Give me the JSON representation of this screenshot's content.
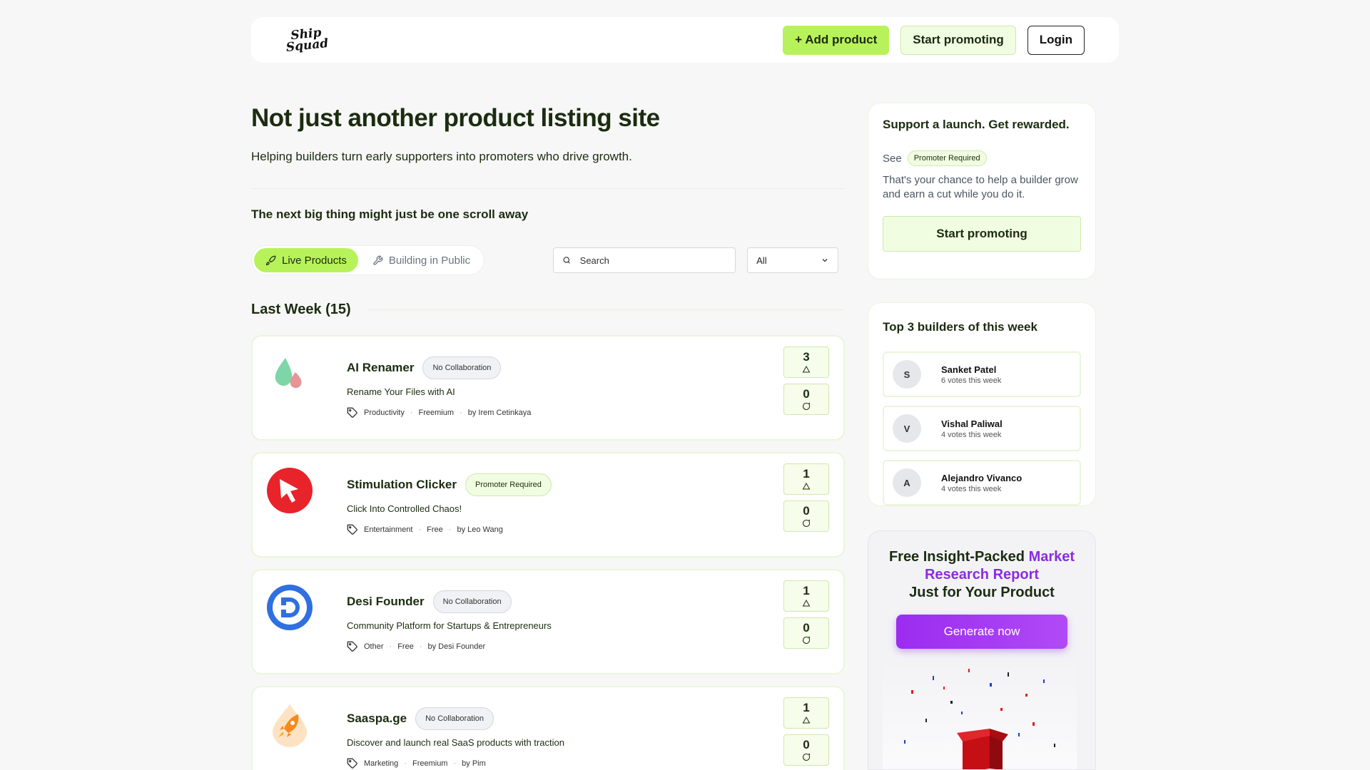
{
  "header": {
    "logo_line1": "Ship",
    "logo_line2": "Squad",
    "add_product": "+ Add product",
    "start_promoting": "Start promoting",
    "login": "Login"
  },
  "hero": {
    "title": "Not just another product listing site",
    "subtitle": "Helping builders turn early supporters into promoters who drive growth.",
    "next_big": "The next big thing might just be one scroll away"
  },
  "filters": {
    "tab_live": "Live Products",
    "tab_building": "Building in Public",
    "search_placeholder": "Search",
    "select_value": "All"
  },
  "section": {
    "title": "Last Week (15)"
  },
  "products": [
    {
      "name": "AI Renamer",
      "badge": "No Collaboration",
      "tagline": "Rename Your Files with AI",
      "category": "Productivity",
      "pricing": "Freemium",
      "author": "by Irem Cetinkaya",
      "upvotes": "3",
      "comments": "0",
      "logo": "drops-logo"
    },
    {
      "name": "Stimulation Clicker",
      "badge": "Promoter Required",
      "tagline": "Click Into Controlled Chaos!",
      "category": "Entertainment",
      "pricing": "Free",
      "author": "by Leo Wang",
      "upvotes": "1",
      "comments": "0",
      "logo": "cursor-logo"
    },
    {
      "name": "Desi Founder",
      "badge": "No Collaboration",
      "tagline": "Community Platform for Startups & Entrepreneurs",
      "category": "Other",
      "pricing": "Free",
      "author": "by Desi Founder",
      "upvotes": "1",
      "comments": "0",
      "logo": "df-logo"
    },
    {
      "name": "Saaspa.ge",
      "badge": "No Collaboration",
      "tagline": "Discover and launch real SaaS products with traction",
      "category": "Marketing",
      "pricing": "Freemium",
      "author": "by Pim",
      "upvotes": "1",
      "comments": "0",
      "logo": "rocket-logo"
    }
  ],
  "support": {
    "title": "Support a launch. Get rewarded.",
    "see": "See",
    "badge": "Promoter Required",
    "desc": "That's your chance to help a builder grow and earn a cut while you do it.",
    "button": "Start promoting"
  },
  "builders": {
    "title": "Top 3 builders of this week",
    "list": [
      {
        "initial": "S",
        "name": "Sanket Patel",
        "votes": "6 votes this week"
      },
      {
        "initial": "V",
        "name": "Vishal Paliwal",
        "votes": "4 votes this week"
      },
      {
        "initial": "A",
        "name": "Alejandro Vivanco",
        "votes": "4 votes this week"
      }
    ]
  },
  "report": {
    "title_part1": "Free Insight-Packed ",
    "title_highlight": "Market Research Report",
    "title_part2": "Just for Your Product",
    "button": "Generate now"
  },
  "colors": {
    "accent": "#b8f25a",
    "purple": "#8a2be2",
    "dark_green": "#1b2c10"
  }
}
